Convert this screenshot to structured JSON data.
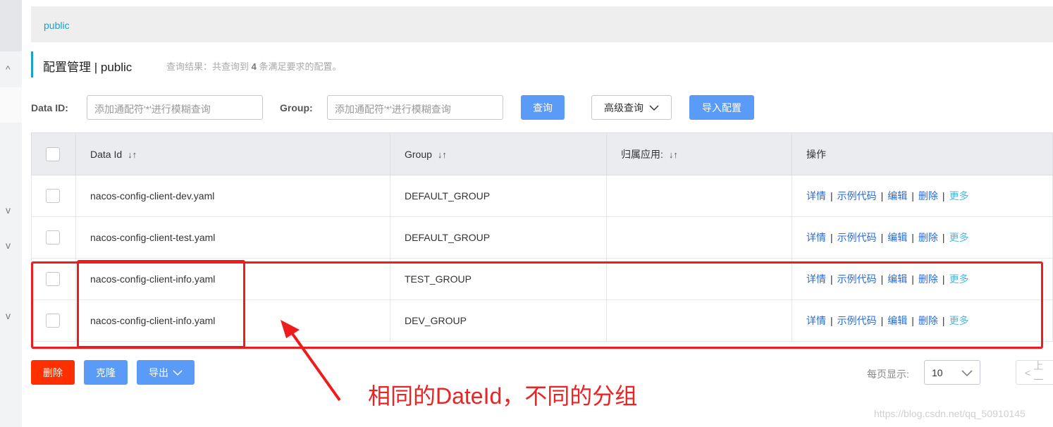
{
  "sidebar": {
    "chevrons": [
      "^",
      "v",
      "v",
      "v"
    ]
  },
  "namespace_tab": "public",
  "header": {
    "title": "配置管理  |  public",
    "result_prefix": "查询结果：共查询到",
    "result_count": "4",
    "result_suffix": "条满足要求的配置。"
  },
  "search": {
    "data_id_label": "Data ID:",
    "data_id_placeholder": "添加通配符'*'进行模糊查询",
    "group_label": "Group:",
    "group_placeholder": "添加通配符'*'进行模糊查询",
    "query_button": "查询",
    "advanced_button": "高级查询",
    "import_button": "导入配置"
  },
  "table": {
    "headers": [
      "Data Id",
      "Group",
      "归属应用:",
      "操作"
    ],
    "sort_icon": "↓↑",
    "rows": [
      {
        "data_id": "nacos-config-client-dev.yaml",
        "group": "DEFAULT_GROUP",
        "app": ""
      },
      {
        "data_id": "nacos-config-client-test.yaml",
        "group": "DEFAULT_GROUP",
        "app": ""
      },
      {
        "data_id": "nacos-config-client-info.yaml",
        "group": "TEST_GROUP",
        "app": ""
      },
      {
        "data_id": "nacos-config-client-info.yaml",
        "group": "DEV_GROUP",
        "app": ""
      }
    ],
    "actions": {
      "detail": "详情",
      "sample": "示例代码",
      "edit": "编辑",
      "delete": "删除",
      "more": "更多",
      "sep": "|"
    }
  },
  "footer": {
    "delete_button": "删除",
    "clone_button": "克隆",
    "export_button": "导出",
    "page_size_label": "每页显示:",
    "page_size_value": "10",
    "prev_button": "上一"
  },
  "annotation": {
    "text": "相同的DateId，不同的分组",
    "color": "#ee1c1c"
  },
  "watermark": "https://blog.csdn.net/qq_50910145"
}
